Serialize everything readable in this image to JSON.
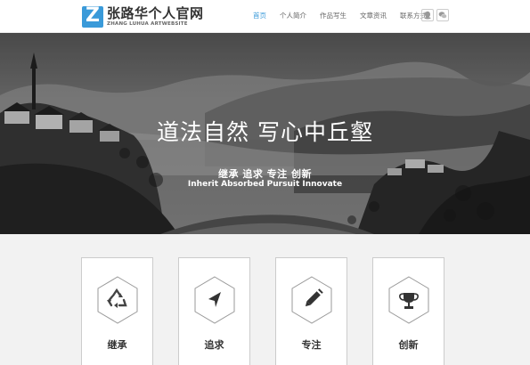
{
  "header": {
    "logo_letter": "Z",
    "logo_cn": "张路华个人官网",
    "logo_en": "ZHANG LUHUA ARTWEBSITE",
    "nav": [
      {
        "label": "首页",
        "active": true
      },
      {
        "label": "个人简介",
        "active": false
      },
      {
        "label": "作品写生",
        "active": false
      },
      {
        "label": "文章资讯",
        "active": false
      },
      {
        "label": "联系方式",
        "active": false
      }
    ],
    "social_icons": [
      "qq-icon",
      "wechat-icon"
    ]
  },
  "hero": {
    "title": "道法自然  写心中丘壑",
    "subtitle_cn": "继承 追求 专注 创新",
    "subtitle_en": "Inherit Absorbed Pursuit Innovate"
  },
  "features": [
    {
      "label": "继承",
      "icon": "recycle-icon"
    },
    {
      "label": "追求",
      "icon": "navigation-arrow-icon"
    },
    {
      "label": "专注",
      "icon": "pencil-icon"
    },
    {
      "label": "创新",
      "icon": "trophy-icon"
    }
  ],
  "colors": {
    "accent": "#3a9ad9",
    "card_border": "#cccccc",
    "features_bg": "#f2f2f2"
  }
}
